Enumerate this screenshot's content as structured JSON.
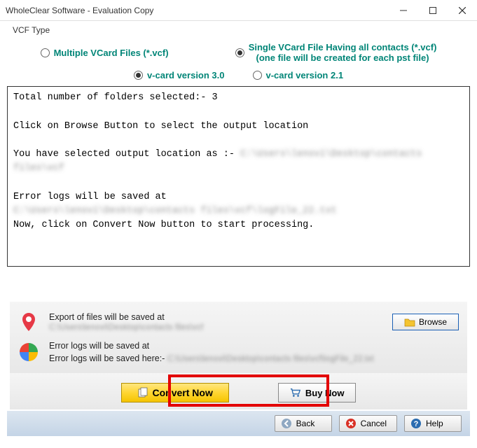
{
  "window": {
    "title": "WholeClear Software - Evaluation Copy"
  },
  "vcf": {
    "type_label": "VCF Type",
    "multi_option": "Multiple VCard Files (*.vcf)",
    "single_option": "Single VCard File Having all contacts (*.vcf)",
    "single_sub": "(one file will be created for each pst file)",
    "version3": "v-card version 3.0",
    "version21": "v-card version 2.1"
  },
  "log": {
    "line1": "Total number of folders selected:- 3",
    "line2": "Click on Browse Button to select the output location",
    "line3a": "You have selected output location as :- ",
    "line3b": "C:\\Users\\lenovi\\Desktop\\contacts files\\vcf",
    "line4": "Error logs will be saved at",
    "line5": "C:\\Users\\lenovi\\Desktop\\contacts files\\vcf\\logFile_22.txt",
    "line6": "Now, click on Convert Now button to start processing."
  },
  "export": {
    "label": "Export of files will be saved at",
    "path": "C:\\Users\\lenovi\\Desktop\\contacts files\\vcf",
    "browse": "Browse"
  },
  "errors": {
    "label": "Error logs will be saved at",
    "prefix": "Error logs will be saved here:- ",
    "path": "C:\\Users\\lenovi\\Desktop\\contacts files\\vcf\\logFile_22.txt"
  },
  "buttons": {
    "convert": "Convert Now",
    "buy": "Buy Now",
    "back": "Back",
    "cancel": "Cancel",
    "help": "Help"
  }
}
